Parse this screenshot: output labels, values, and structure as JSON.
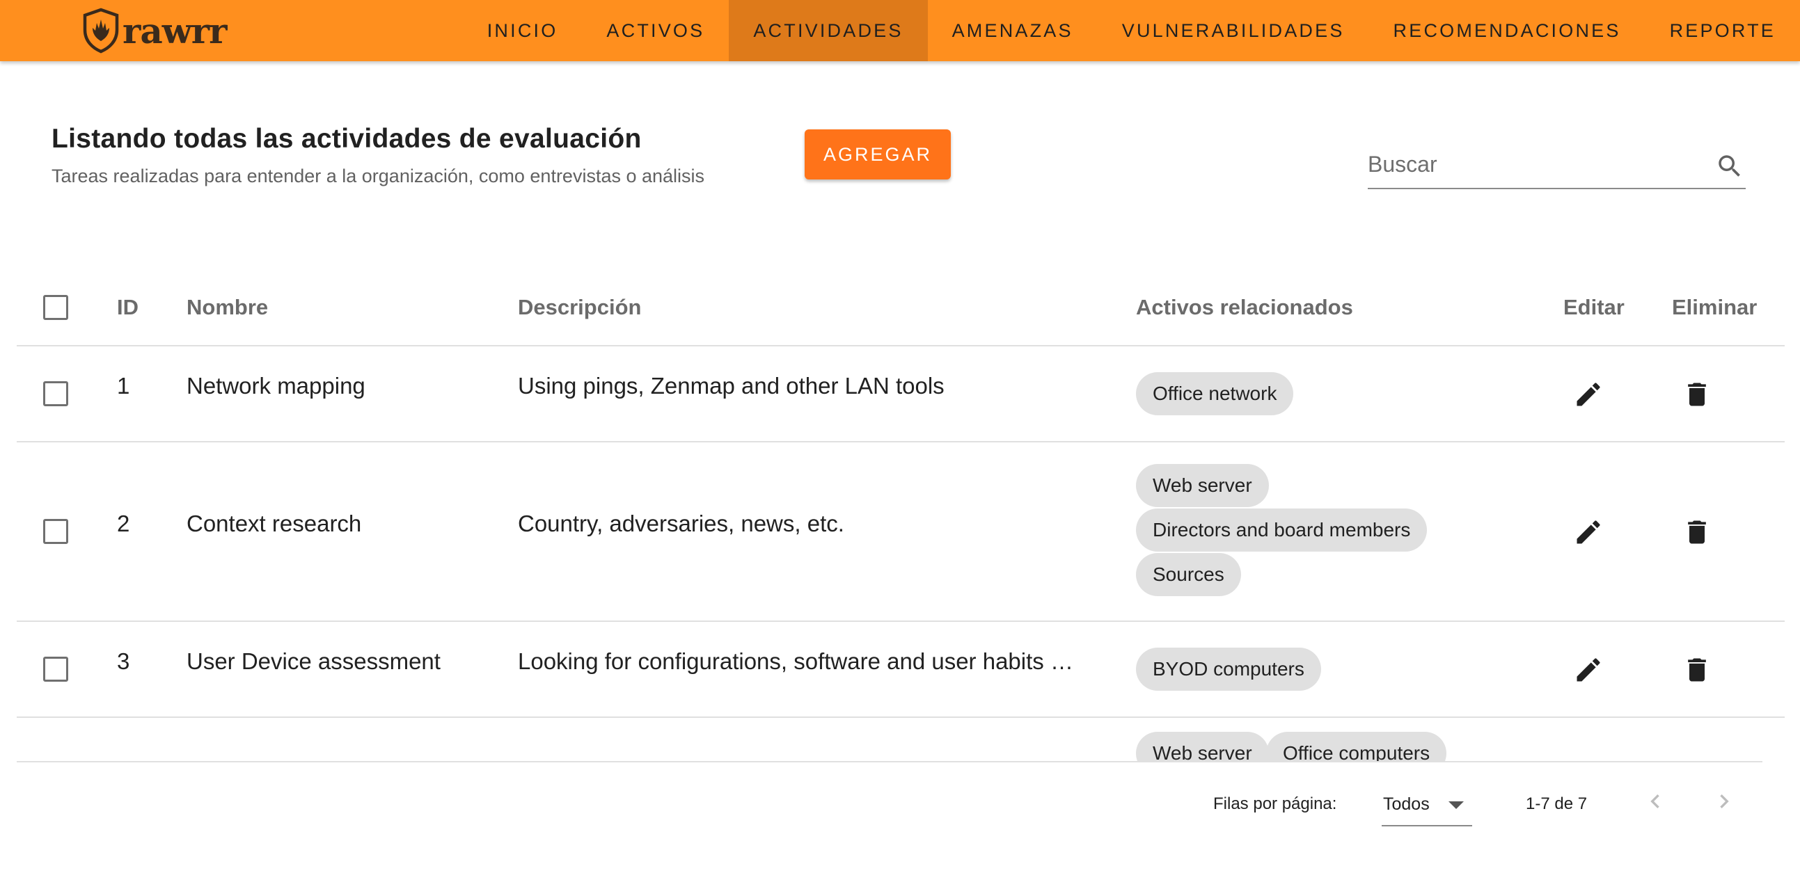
{
  "app": {
    "logo_text": "rawrr",
    "accent_color": "#ff8f1e",
    "active_tab_color": "#de7a1a",
    "button_color": "#ff7319"
  },
  "nav": {
    "items": [
      {
        "label": "INICIO"
      },
      {
        "label": "ACTIVOS"
      },
      {
        "label": "ACTIVIDADES",
        "active": true
      },
      {
        "label": "AMENAZAS"
      },
      {
        "label": "VULNERABILIDADES"
      },
      {
        "label": "RECOMENDACIONES"
      },
      {
        "label": "REPORTE"
      }
    ]
  },
  "header": {
    "title": "Listando todas las actividades de evaluación",
    "subtitle": "Tareas realizadas para entender a la organización, como entrevistas o análisis",
    "add_label": "AGREGAR"
  },
  "search": {
    "placeholder": "Buscar",
    "icon": "search-icon"
  },
  "table": {
    "columns": {
      "id": "ID",
      "name": "Nombre",
      "description": "Descripción",
      "assets": "Activos relacionados",
      "edit": "Editar",
      "delete": "Eliminar"
    },
    "rows": [
      {
        "id": "1",
        "name": "Network mapping",
        "description": "Using pings, Zenmap and other LAN tools",
        "assets": [
          "Office network"
        ]
      },
      {
        "id": "2",
        "name": "Context research",
        "description": "Country, adversaries, news, etc.",
        "assets": [
          "Web server",
          "Directors and board members",
          "Sources"
        ]
      },
      {
        "id": "3",
        "name": "User Device assessment",
        "description": "Looking for configurations, software and user habits …",
        "assets": [
          "BYOD computers"
        ]
      },
      {
        "id": "",
        "name": "",
        "description": "",
        "assets": [
          "Web server",
          "Office computers"
        ]
      }
    ]
  },
  "footer": {
    "rows_per_page_label": "Filas por página:",
    "rows_per_page_value": "Todos",
    "range_text": "1-7 de 7"
  }
}
